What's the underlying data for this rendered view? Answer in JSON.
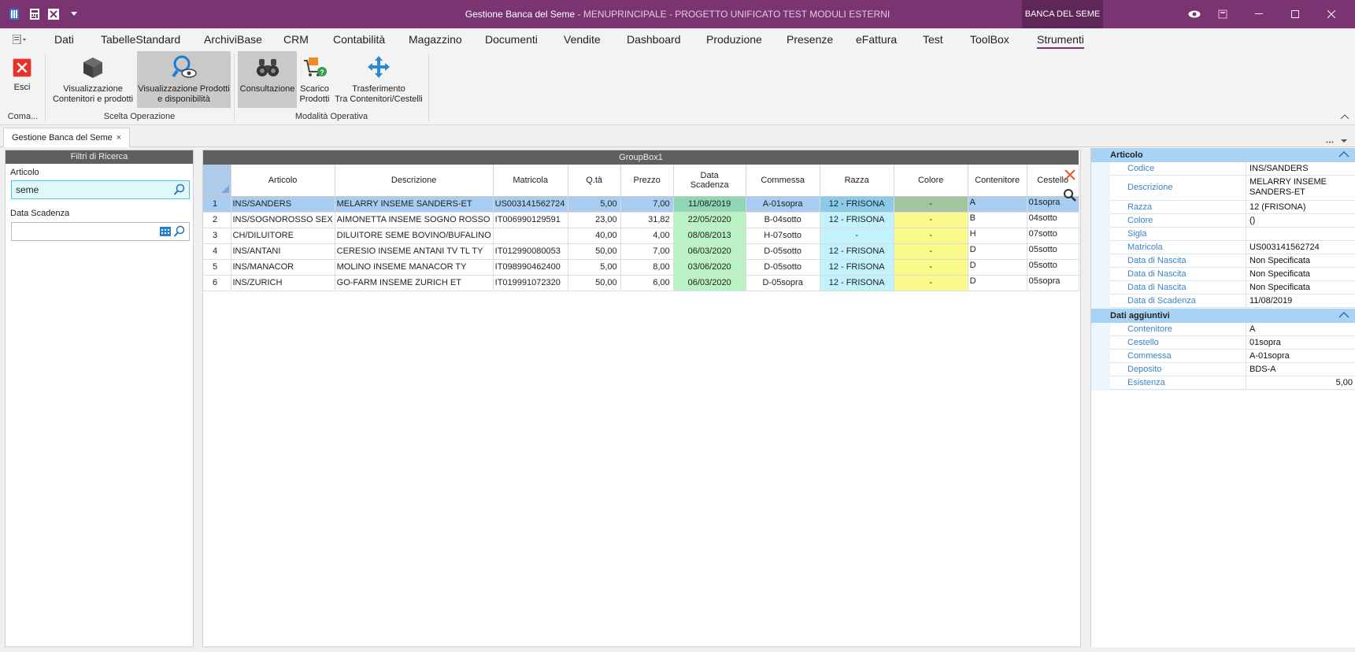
{
  "titlebar": {
    "title": "Gestione Banca del Seme",
    "subtitle": " - MENUPRINCIPALE - PROGETTO UNIFICATO TEST MODULI ESTERNI",
    "badge": "BANCA DEL SEME",
    "quick_access_icons": [
      "app-icon",
      "calculator-icon",
      "excel-icon",
      "dropdown-arrow-icon"
    ],
    "window_icons": [
      "eye-icon",
      "restore-icon",
      "minimize-icon",
      "maximize-icon",
      "close-icon"
    ]
  },
  "menu": {
    "items": [
      "Dati",
      "TabelleStandard",
      "ArchiviBase",
      "CRM",
      "Contabilità",
      "Magazzino",
      "Documenti",
      "Vendite",
      "Dashboard",
      "Produzione",
      "Presenze",
      "eFattura",
      "Test",
      "ToolBox",
      "Strumenti"
    ],
    "active": "Strumenti"
  },
  "ribbon": {
    "buttons": {
      "esci": "Esci",
      "vis_cont_1": "Visualizzazione",
      "vis_cont_2": "Contenitori e prodotti",
      "vis_prod_1": "Visualizzazione Prodotti",
      "vis_prod_2": "e disponibilità",
      "consultazione": "Consultazione",
      "scarico_1": "Scarico",
      "scarico_2": "Prodotti",
      "trasf_1": "Trasferimento",
      "trasf_2": "Tra Contenitori/Cestelli"
    },
    "groups": {
      "comandi": "Coma...",
      "scelta": "Scelta Operazione",
      "modalita": "Modalità Operativa"
    }
  },
  "doc_tab": {
    "label": "Gestione Banca del Seme",
    "close": "×"
  },
  "filters": {
    "title": "Filtri di Ricerca",
    "articolo_label": "Articolo",
    "articolo_value": "seme",
    "scadenza_label": "Data Scadenza",
    "scadenza_value": ""
  },
  "grid": {
    "title": "GroupBox1",
    "headers": {
      "articolo": "Articolo",
      "descrizione": "Descrizione",
      "matricola": "Matricola",
      "qta": "Q.tà",
      "prezzo": "Prezzo",
      "scadenza_1": "Data",
      "scadenza_2": "Scadenza",
      "commessa": "Commessa",
      "razza": "Razza",
      "colore": "Colore",
      "contenitore": "Contenitore",
      "cestello": "Cestello"
    },
    "rows": [
      {
        "n": "1",
        "articolo": "INS/SANDERS",
        "descrizione": "MELARRY INSEME SANDERS-ET",
        "matricola": "US003141562724",
        "qta": "5,00",
        "prezzo": "7,00",
        "scadenza": "11/08/2019",
        "commessa": "A-01sopra",
        "razza": "12 - FRISONA",
        "colore": "-",
        "contenitore": "A",
        "cestello": "01sopra"
      },
      {
        "n": "2",
        "articolo": "INS/SOGNOROSSO SEX",
        "descrizione": "AIMONETTA INSEME SOGNO ROSSO",
        "matricola": "IT006990129591",
        "qta": "23,00",
        "prezzo": "31,82",
        "scadenza": "22/05/2020",
        "commessa": "B-04sotto",
        "razza": "12 - FRISONA",
        "colore": "-",
        "contenitore": "B",
        "cestello": "04sotto"
      },
      {
        "n": "3",
        "articolo": "CH/DILUITORE",
        "descrizione": "DILUITORE SEME BOVINO/BUFALINO",
        "matricola": "",
        "qta": "40,00",
        "prezzo": "4,00",
        "scadenza": "08/08/2013",
        "commessa": "H-07sotto",
        "razza": "-",
        "colore": "-",
        "contenitore": "H",
        "cestello": "07sotto"
      },
      {
        "n": "4",
        "articolo": "INS/ANTANI",
        "descrizione": "CERESIO INSEME ANTANI TV TL TY",
        "matricola": "IT012990080053",
        "qta": "50,00",
        "prezzo": "7,00",
        "scadenza": "06/03/2020",
        "commessa": "D-05sotto",
        "razza": "12 - FRISONA",
        "colore": "-",
        "contenitore": "D",
        "cestello": "05sotto"
      },
      {
        "n": "5",
        "articolo": "INS/MANACOR",
        "descrizione": "MOLINO INSEME MANACOR TY",
        "matricola": "IT098990462400",
        "qta": "5,00",
        "prezzo": "8,00",
        "scadenza": "03/06/2020",
        "commessa": "D-05sotto",
        "razza": "12 - FRISONA",
        "colore": "-",
        "contenitore": "D",
        "cestello": "05sotto"
      },
      {
        "n": "6",
        "articolo": "INS/ZURICH",
        "descrizione": "GO-FARM INSEME ZURICH ET",
        "matricola": "IT019991072320",
        "qta": "50,00",
        "prezzo": "6,00",
        "scadenza": "06/03/2020",
        "commessa": "D-05sopra",
        "razza": "12 - FRISONA",
        "colore": "-",
        "contenitore": "D",
        "cestello": "05sopra"
      }
    ],
    "selected_row": 1
  },
  "properties": {
    "articolo_title": "Articolo",
    "dati_title": "Dati aggiuntivi",
    "articolo": [
      {
        "k": "Codice",
        "v": "INS/SANDERS"
      },
      {
        "k": "Descrizione",
        "v": "MELARRY INSEME SANDERS-ET"
      },
      {
        "k": "Razza",
        "v": "12 (FRISONA)"
      },
      {
        "k": "Colore",
        "v": "()"
      },
      {
        "k": "Sigla",
        "v": ""
      },
      {
        "k": "Matricola",
        "v": "US003141562724"
      },
      {
        "k": "Data di Nascita",
        "v": "Non Specificata"
      },
      {
        "k": "Data di Nascita",
        "v": "Non Specificata"
      },
      {
        "k": "Data di Nascita",
        "v": "Non Specificata"
      },
      {
        "k": "Data di Scadenza",
        "v": "11/08/2019"
      }
    ],
    "dati": [
      {
        "k": "Contenitore",
        "v": "A"
      },
      {
        "k": "Cestello",
        "v": "01sopra"
      },
      {
        "k": "Commessa",
        "v": "A-01sopra"
      },
      {
        "k": "Deposito",
        "v": "BDS-A"
      },
      {
        "k": "Esistenza",
        "v": "5,00"
      }
    ]
  },
  "colors": {
    "title_bar": "#7a3472",
    "selected_row": "#a8cdf0",
    "scadenza_cell": "#b9f2c3",
    "razza_cell": "#c2f2fb",
    "colore_cell": "#fbfb8c",
    "property_header": "#a9d3f5"
  }
}
